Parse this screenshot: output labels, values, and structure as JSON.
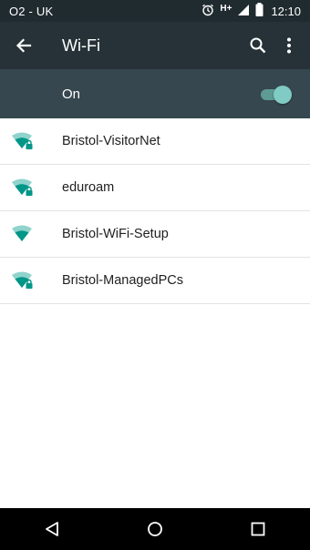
{
  "status_bar": {
    "carrier": "O2 - UK",
    "network_type": "H+",
    "time": "12:10",
    "icons": [
      "alarm-icon",
      "cell-signal-icon",
      "battery-icon"
    ]
  },
  "app_bar": {
    "title": "Wi-Fi",
    "icons": [
      "back-arrow-icon",
      "search-icon",
      "more-vert-icon"
    ]
  },
  "wifi_switch": {
    "label": "On",
    "state": true
  },
  "networks": [
    {
      "ssid": "Bristol-VisitorNet",
      "secured": true
    },
    {
      "ssid": "eduroam",
      "secured": true
    },
    {
      "ssid": "Bristol-WiFi-Setup",
      "secured": false
    },
    {
      "ssid": "Bristol-ManagedPCs",
      "secured": true
    }
  ],
  "nav_bar": {
    "icons": [
      "back-triangle-icon",
      "home-circle-icon",
      "recents-square-icon"
    ]
  },
  "colors": {
    "status_bar_bg": "#202b30",
    "app_bar_bg": "#263238",
    "switch_bar_bg": "#37474f",
    "accent_teal": "#009688",
    "toggle_thumb": "#80cbc4"
  }
}
